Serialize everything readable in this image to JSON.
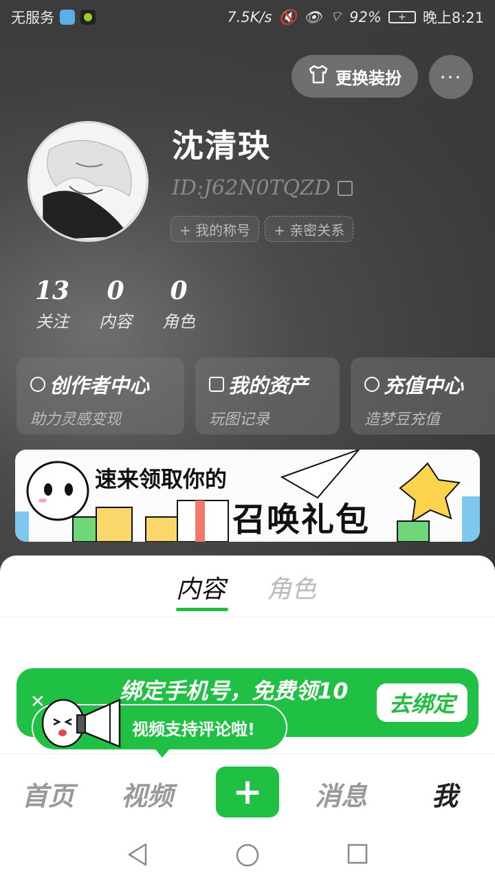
{
  "status_bar": {
    "carrier": "无服务",
    "net_speed": "7.5K/s",
    "battery_pct": "92%",
    "time": "晚上8:21"
  },
  "header": {
    "outfit_button": "更换装扮",
    "more_button": "···"
  },
  "profile": {
    "name": "沈清玦",
    "id": "ID:J62N0TQZD",
    "tags": [
      "+ 我的称号",
      "+ 亲密关系"
    ]
  },
  "stats": [
    {
      "value": "13",
      "label": "关注"
    },
    {
      "value": "0",
      "label": "内容"
    },
    {
      "value": "0",
      "label": "角色"
    }
  ],
  "cards": [
    {
      "title": "创作者中心",
      "subtitle": "助力灵感变现",
      "icon": "refresh-icon"
    },
    {
      "title": "我的资产",
      "subtitle": "玩图记录",
      "icon": "folder-icon"
    },
    {
      "title": "充值中心",
      "subtitle": "造梦豆充值",
      "icon": "compass-icon"
    }
  ],
  "banner": {
    "line1": "速来领取你的",
    "line2": "召唤礼包"
  },
  "content_tabs": [
    "内容",
    "角色"
  ],
  "bind_phone": {
    "text": "绑定手机号，免费领10",
    "button": "去绑定"
  },
  "tooltip": "视频支持评论啦!",
  "bottom_nav": [
    "首页",
    "视频",
    "+",
    "消息",
    "我"
  ],
  "colors": {
    "accent": "#1fc043"
  }
}
